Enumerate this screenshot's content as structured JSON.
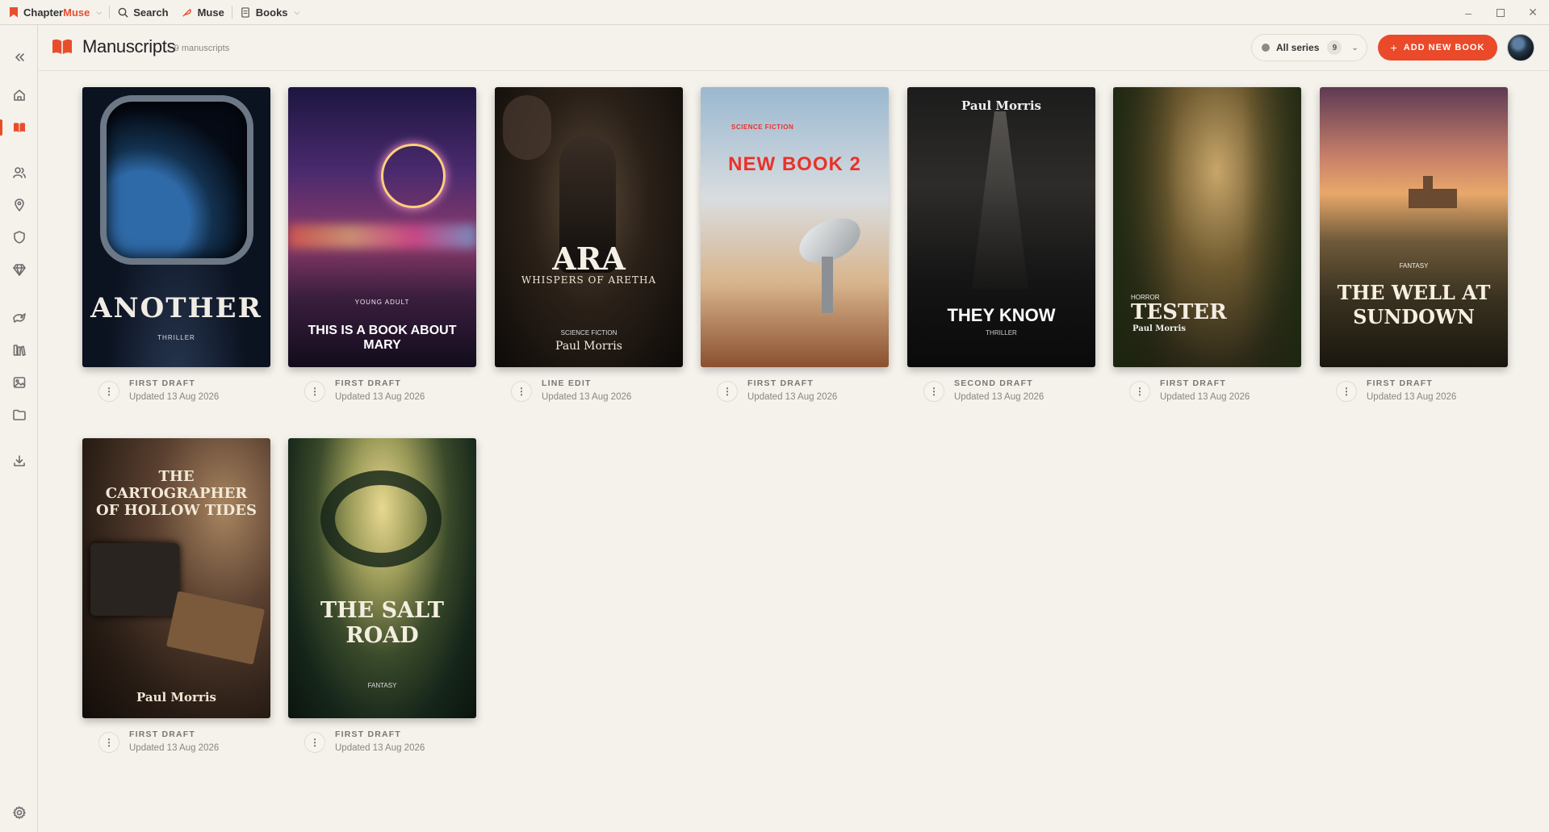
{
  "titlebar": {
    "brand_part1": "Chapter",
    "brand_part2": "Muse",
    "search_label": "Search",
    "muse_label": "Muse",
    "books_label": "Books"
  },
  "header": {
    "title": "Manuscripts",
    "count": "· 9 manuscripts",
    "series_filter_label": "All series",
    "series_count": "9",
    "add_button_label": "ADD NEW BOOK"
  },
  "colors": {
    "accent": "#ea4a2a",
    "background": "#f5f2ec"
  },
  "sidebar_icons": [
    "collapse-icon",
    "home-icon",
    "book-icon",
    "people-icon",
    "location-pin-icon",
    "shield-icon",
    "gem-icon",
    "pets-icon",
    "library-icon",
    "image-icon",
    "folder-icon",
    "download-icon",
    "settings-icon"
  ],
  "books": [
    {
      "cover_title": "ANOTHER",
      "genre": "THRILLER",
      "author": "",
      "stage": "FIRST DRAFT",
      "updated": "Updated 13 Aug 2026"
    },
    {
      "cover_title": "THIS IS A BOOK ABOUT MARY",
      "genre": "YOUNG ADULT",
      "author": "",
      "stage": "FIRST DRAFT",
      "updated": "Updated 13 Aug 2026"
    },
    {
      "cover_title": "ARA",
      "subtitle": "WHISPERS OF ARETHA",
      "genre": "SCIENCE FICTION",
      "author": "Paul Morris",
      "stage": "LINE EDIT",
      "updated": "Updated 13 Aug 2026"
    },
    {
      "cover_title": "NEW BOOK 2",
      "genre": "SCIENCE FICTION",
      "author": "",
      "stage": "FIRST DRAFT",
      "updated": "Updated 13 Aug 2026"
    },
    {
      "cover_title": "THEY KNOW",
      "genre": "THRILLER",
      "author": "Paul Morris",
      "stage": "SECOND DRAFT",
      "updated": "Updated 13 Aug 2026"
    },
    {
      "cover_title": "TESTER",
      "genre": "HORROR",
      "author": "Paul Morris",
      "stage": "FIRST DRAFT",
      "updated": "Updated 13 Aug 2026"
    },
    {
      "cover_title": "THE WELL AT SUNDOWN",
      "genre": "FANTASY",
      "author": "",
      "stage": "FIRST DRAFT",
      "updated": "Updated 13 Aug 2026"
    },
    {
      "cover_title": "THE CARTOGRAPHER OF HOLLOW TIDES",
      "genre": "",
      "author": "Paul Morris",
      "stage": "FIRST DRAFT",
      "updated": "Updated 13 Aug 2026"
    },
    {
      "cover_title": "THE SALT ROAD",
      "genre": "FANTASY",
      "author": "",
      "stage": "FIRST DRAFT",
      "updated": "Updated 13 Aug 2026"
    }
  ]
}
